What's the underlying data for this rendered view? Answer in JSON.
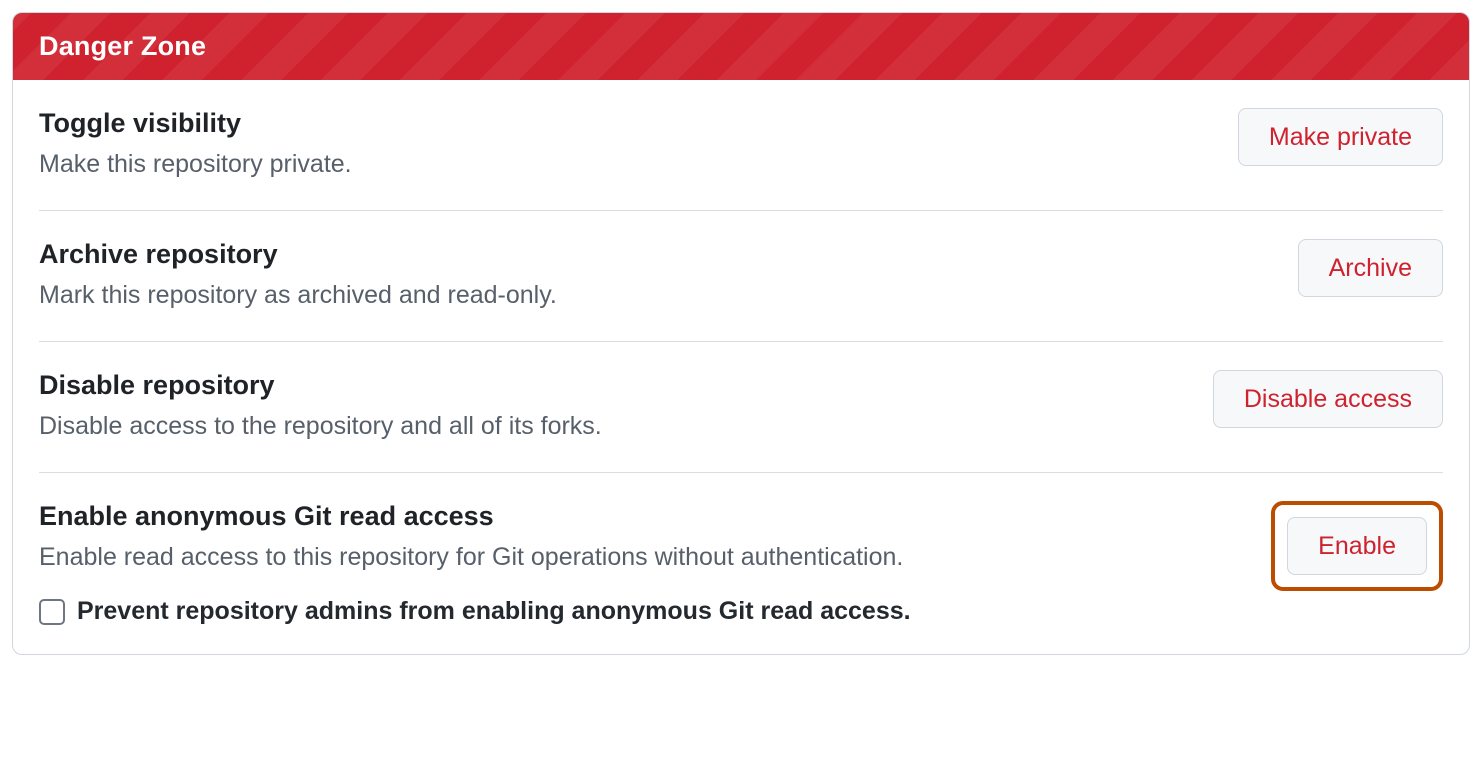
{
  "dangerZone": {
    "header": "Danger Zone",
    "items": [
      {
        "title": "Toggle visibility",
        "desc": "Make this repository private.",
        "button": "Make private"
      },
      {
        "title": "Archive repository",
        "desc": "Mark this repository as archived and read-only.",
        "button": "Archive"
      },
      {
        "title": "Disable repository",
        "desc": "Disable access to the repository and all of its forks.",
        "button": "Disable access"
      },
      {
        "title": "Enable anonymous Git read access",
        "desc": "Enable read access to this repository for Git operations without authentication.",
        "button": "Enable",
        "checkboxLabel": "Prevent repository admins from enabling anonymous Git read access."
      }
    ]
  }
}
